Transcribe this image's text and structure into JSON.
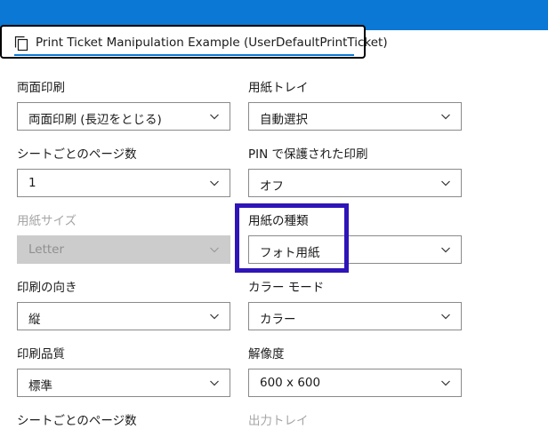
{
  "tab": {
    "title": "Print Ticket Manipulation Example (UserDefaultPrintTicket)",
    "icon": "copy-icon"
  },
  "fields": [
    {
      "id": "duplex",
      "label": "両面印刷",
      "value": "両面印刷 (長辺をとじる)",
      "disabled": false
    },
    {
      "id": "input-bin",
      "label": "用紙トレイ",
      "value": "自動選択",
      "disabled": false
    },
    {
      "id": "pages-per-sheet",
      "label": "シートごとのページ数",
      "value": "1",
      "disabled": false
    },
    {
      "id": "pin-print",
      "label": "PIN で保護された印刷",
      "value": "オフ",
      "disabled": false
    },
    {
      "id": "paper-size",
      "label": "用紙サイズ",
      "value": "Letter",
      "disabled": true
    },
    {
      "id": "paper-type",
      "label": "用紙の種類",
      "value": "フォト用紙",
      "disabled": false
    },
    {
      "id": "orientation",
      "label": "印刷の向き",
      "value": "縦",
      "disabled": false
    },
    {
      "id": "color-mode",
      "label": "カラー モード",
      "value": "カラー",
      "disabled": false
    },
    {
      "id": "print-quality",
      "label": "印刷品質",
      "value": "標準",
      "disabled": false
    },
    {
      "id": "resolution",
      "label": "解像度",
      "value": "600 x 600",
      "disabled": false
    }
  ],
  "cut_labels": {
    "left": "シートごとのページ数",
    "right": "出力トレイ"
  },
  "colors": {
    "accent": "#0a78d4",
    "highlight": "#2f15b8"
  }
}
